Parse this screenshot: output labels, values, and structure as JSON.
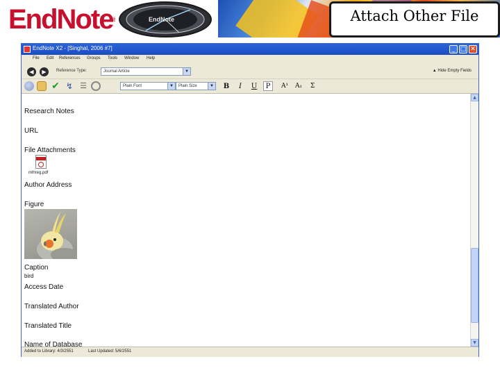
{
  "slide": {
    "logo_text": "EndNote",
    "logo_mark": "®",
    "title": "Attach Other File"
  },
  "window": {
    "title": "EndNote X2 - [Singhal, 2006 #7]",
    "buttons": {
      "minimize": "_",
      "maximize": "□",
      "close": "✕"
    }
  },
  "menu": [
    "File",
    "Edit",
    "References",
    "Groups",
    "Tools",
    "Window",
    "Help"
  ],
  "toolbar1": {
    "ref_type_label": "Reference Type:",
    "ref_type_value": "Journal Article",
    "hide_empty": "Hide Empty Fields"
  },
  "toolbar2": {
    "font_value": "Plain Font",
    "size_value": "Plain Size",
    "bold": "B",
    "italic": "I",
    "underline": "U",
    "plain": "P",
    "superscript": "A¹",
    "subscript": "A₁",
    "symbol": "Σ"
  },
  "fields": {
    "research_notes": "Research Notes",
    "url": "URL",
    "file_attachments": "File Attachments",
    "attachment_name": "mlhreg.pdf",
    "author_address": "Author Address",
    "figure": "Figure",
    "caption": "Caption",
    "caption_value": "bird",
    "access_date": "Access Date",
    "translated_author": "Translated Author",
    "translated_title": "Translated Title",
    "name_of_database": "Name of Database"
  },
  "status": {
    "added": "Added to Library: 4/3/2551",
    "updated": "Last Updated: 5/6/2551"
  },
  "colors": {
    "titlebar": "#2a63d9",
    "logo_red": "#c8102e",
    "scroll_thumb": "#c2d3f6"
  }
}
